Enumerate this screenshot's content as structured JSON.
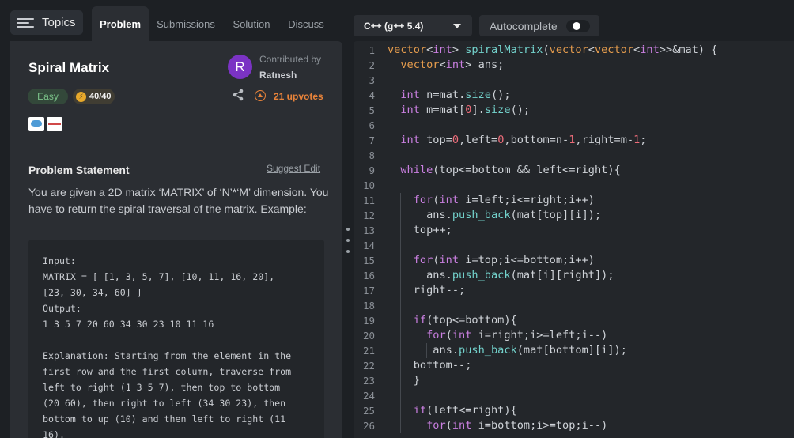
{
  "topbar": {
    "topics_label": "Topics",
    "tabs": [
      {
        "label": "Problem",
        "active": true
      },
      {
        "label": "Submissions",
        "active": false
      },
      {
        "label": "Solution",
        "active": false
      },
      {
        "label": "Discuss",
        "active": false
      }
    ]
  },
  "problem": {
    "title": "Spiral Matrix",
    "difficulty": "Easy",
    "points": "40/40",
    "contributed_by_label": "Contributed by",
    "contributor": "Ratnesh",
    "avatar_initial": "R",
    "upvotes": "21 upvotes",
    "statement_heading": "Problem Statement",
    "suggest_edit": "Suggest Edit",
    "description": "You are given a 2D matrix ‘MATRIX’ of ‘N’*‘M’ dimension. You have to return the spiral traversal of the matrix. Example:",
    "example": "Input:\nMATRIX = [ [1, 3, 5, 7], [10, 11, 16, 20],\n[23, 30, 34, 60] ]\nOutput:\n1 3 5 7 20 60 34 30 23 10 11 16\n\nExplanation: Starting from the element in the\nfirst row and the first column, traverse from\nleft to right (1 3 5 7), then top to bottom\n(20 60), then right to left (34 30 23), then\nbottom to up (10) and then left to right (11\n16)."
  },
  "editor": {
    "language": "C++ (g++ 5.4)",
    "autocomplete_label": "Autocomplete",
    "autocomplete_on": false,
    "lines": [
      "vector<int> spiralMatrix(vector<vector<int>>&mat) {",
      "  vector<int> ans;",
      "",
      "  int n=mat.size();",
      "  int m=mat[0].size();",
      "",
      "  int top=0,left=0,bottom=n-1,right=m-1;",
      "",
      "  while(top<=bottom && left<=right){",
      "",
      "    for(int i=left;i<=right;i++)",
      "      ans.push_back(mat[top][i]);",
      "    top++;",
      "",
      "    for(int i=top;i<=bottom;i++)",
      "      ans.push_back(mat[i][right]);",
      "    right--;",
      "",
      "    if(top<=bottom){",
      "      for(int i=right;i>=left;i--)",
      "       ans.push_back(mat[bottom][i]);",
      "    bottom--;",
      "    }",
      "",
      "    if(left<=right){",
      "      for(int i=bottom;i>=top;i--)"
    ]
  },
  "colors": {
    "background": "#1d2024",
    "panel": "#2b2e33",
    "accent_orange": "#e8833a",
    "easy_green": "#7cc48a",
    "keyword": "#c97fe0",
    "type": "#e59c4d",
    "function": "#73d2cc",
    "number": "#ee6d7a"
  },
  "icons": [
    "menu-icon",
    "bolt-icon",
    "share-icon",
    "upvote-icon",
    "chevron-down-icon"
  ]
}
